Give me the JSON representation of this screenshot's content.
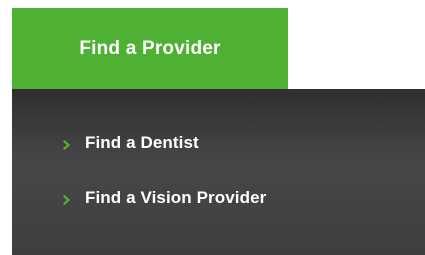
{
  "colors": {
    "accent_green": "#4fb134",
    "menu_background": "#3e3e3e",
    "text_white": "#ffffff"
  },
  "tab": {
    "label": "Find a Provider"
  },
  "dropdown": {
    "items": [
      {
        "label": "Find a Dentist",
        "icon": "chevron-right-icon"
      },
      {
        "label": "Find a Vision Provider",
        "icon": "chevron-right-icon"
      }
    ]
  }
}
